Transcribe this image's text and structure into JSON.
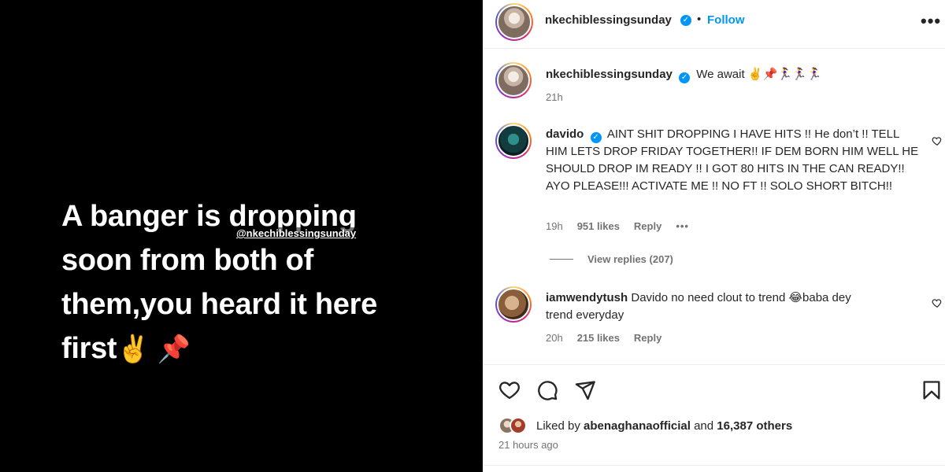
{
  "media": {
    "lines": [
      "A banger is dropping",
      "soon from both of",
      "them,you heard it here",
      "first"
    ],
    "emojis": "✌️ 📌",
    "mention_tag": "@nkechiblessingsunday"
  },
  "header": {
    "username": "nkechiblessingsunday",
    "separator": "•",
    "follow_label": "Follow",
    "more_label": "•••"
  },
  "caption": {
    "username": "nkechiblessingsunday",
    "text": "We await ✌️📌🏃‍♀️🏃‍♀️🏃‍♀️",
    "time": "21h"
  },
  "comments": [
    {
      "username": "davido",
      "verified": true,
      "text": "AINT SHIT DROPPING I HAVE HITS !! He don’t !! TELL HIM LETS DROP FRIDAY TOGETHER!! IF DEM BORN HIM WELL HE SHOULD DROP IM READY !! I GOT 80 HITS IN THE CAN READY!! AYO PLEASE!!! ACTIVATE ME !! NO FT !! SOLO SHORT BITCH!!",
      "time": "19h",
      "likes": "951 likes",
      "reply_label": "Reply",
      "more_label": "•••",
      "view_replies": "View replies (207)"
    },
    {
      "username": "iamwendytush",
      "verified": false,
      "text": "Davido no need clout to trend 😂baba dey trend everyday",
      "time": "20h",
      "likes": "215 likes",
      "reply_label": "Reply"
    }
  ],
  "likes": {
    "prefix": "Liked by",
    "user": "abenaghanaofficial",
    "middle": "and",
    "others": "16,387 others"
  },
  "posted": "21 hours ago",
  "colors": {
    "link_blue": "#0095f6",
    "muted_text": "#737373",
    "text": "#262626"
  },
  "icons": [
    "heart-icon",
    "comment-icon",
    "share-icon",
    "bookmark-icon",
    "verified-icon",
    "more-icon"
  ]
}
